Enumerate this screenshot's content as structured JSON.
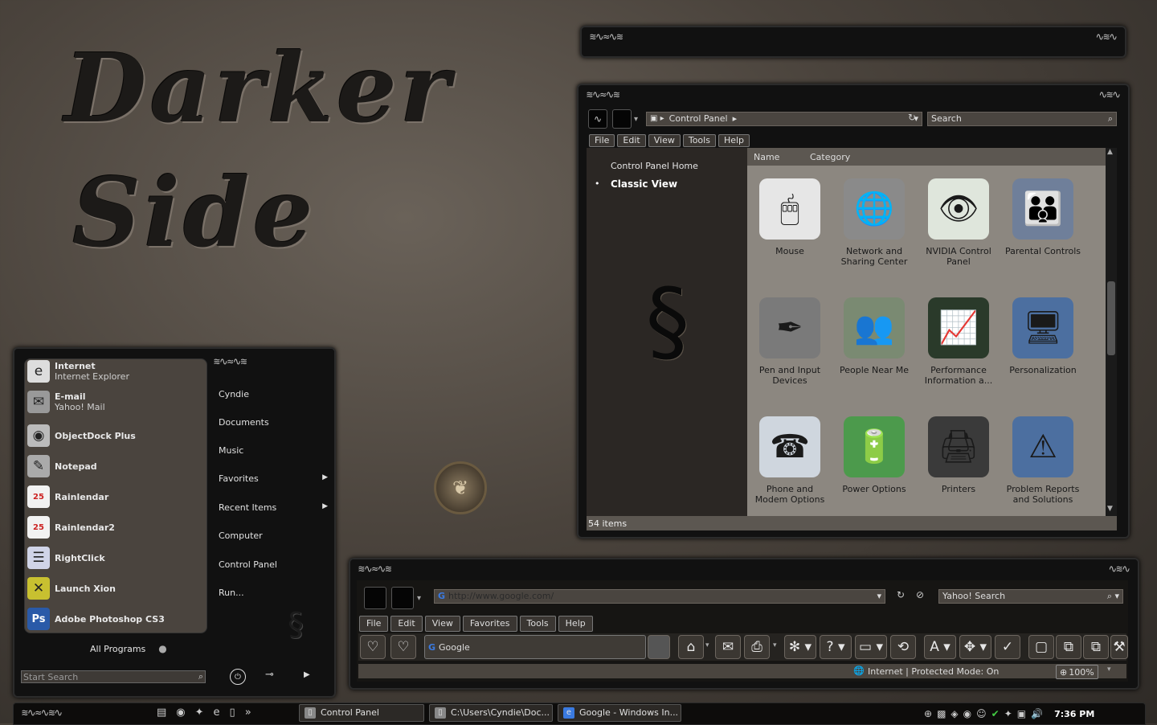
{
  "desktop": {
    "title_line1": "Darker",
    "title_line2": "Side"
  },
  "explorer": {
    "address": {
      "path_label": "Control Panel"
    },
    "search": {
      "placeholder": "Search"
    },
    "menu": [
      "File",
      "Edit",
      "View",
      "Tools",
      "Help"
    ],
    "side": {
      "home_label": "Control Panel Home",
      "classic_label": "Classic View"
    },
    "columns": {
      "name": "Name",
      "category": "Category"
    },
    "items": [
      {
        "label": "Mouse",
        "icon": "mouse-icon",
        "glyph": "🖱",
        "bg": "#e6e6e6"
      },
      {
        "label": "Network and Sharing Center",
        "icon": "globe-icon",
        "glyph": "🌐",
        "bg": "#8a8a8a"
      },
      {
        "label": "NVIDIA Control Panel",
        "icon": "nvidia-icon",
        "glyph": "👁",
        "bg": "#dfe6dc"
      },
      {
        "label": "Parental Controls",
        "icon": "parental-controls-icon",
        "glyph": "👪",
        "bg": "#6f7f9a"
      },
      {
        "label": "Pen and Input Devices",
        "icon": "pen-icon",
        "glyph": "✒",
        "bg": "#7a7a7a"
      },
      {
        "label": "People Near Me",
        "icon": "people-icon",
        "glyph": "👥",
        "bg": "#7a8a72"
      },
      {
        "label": "Performance Information a...",
        "icon": "performance-icon",
        "glyph": "📈",
        "bg": "#2a3a2a"
      },
      {
        "label": "Personalization",
        "icon": "personalization-icon",
        "glyph": "🖥",
        "bg": "#4c6fa0"
      },
      {
        "label": "Phone and Modem Options",
        "icon": "phone-icon",
        "glyph": "☎",
        "bg": "#cfd6de"
      },
      {
        "label": "Power Options",
        "icon": "battery-icon",
        "glyph": "🔋",
        "bg": "#4c9a4c"
      },
      {
        "label": "Printers",
        "icon": "printer-icon",
        "glyph": "🖨",
        "bg": "#3a3a3a"
      },
      {
        "label": "Problem Reports and Solutions",
        "icon": "problem-reports-icon",
        "glyph": "⚠",
        "bg": "#4c6fa0"
      }
    ],
    "status": "54 items"
  },
  "browser": {
    "url": "http://www.google.com/",
    "search_placeholder": "Yahoo! Search",
    "menu": [
      "File",
      "Edit",
      "View",
      "Favorites",
      "Tools",
      "Help"
    ],
    "tab_label": "Google",
    "status_zone": "Internet | Protected Mode: On",
    "zoom": "100%"
  },
  "start_menu": {
    "pinned": [
      {
        "title": "Internet",
        "sub": "Internet Explorer",
        "icon": "ie-icon",
        "glyph": "e",
        "bg": "#ddd"
      },
      {
        "title": "E-mail",
        "sub": "Yahoo! Mail",
        "icon": "mail-icon",
        "glyph": "✉",
        "bg": "#999"
      },
      {
        "title": "ObjectDock Plus",
        "sub": "",
        "icon": "objectdock-icon",
        "glyph": "◉",
        "bg": "#bbb"
      },
      {
        "title": "Notepad",
        "sub": "",
        "icon": "notepad-icon",
        "glyph": "✎",
        "bg": "#aaa"
      },
      {
        "title": "Rainlendar",
        "sub": "",
        "icon": "calendar-icon",
        "glyph": "25",
        "bg": "#f2f2f2"
      },
      {
        "title": "Rainlendar2",
        "sub": "",
        "icon": "calendar-icon",
        "glyph": "25",
        "bg": "#f2f2f2"
      },
      {
        "title": "RightClick",
        "sub": "",
        "icon": "rightclick-icon",
        "glyph": "☰",
        "bg": "#d0d4e8"
      },
      {
        "title": "Launch Xion",
        "sub": "",
        "icon": "xion-icon",
        "glyph": "✕",
        "bg": "#c8c030"
      },
      {
        "title": "Adobe Photoshop CS3",
        "sub": "",
        "icon": "photoshop-icon",
        "glyph": "Ps",
        "bg": "#2a5aa8"
      }
    ],
    "all_programs": "All Programs",
    "search_placeholder": "Start Search",
    "right": [
      "Cyndie",
      "Documents",
      "Music",
      "Favorites",
      "Recent Items",
      "Computer",
      "Control Panel",
      "Run..."
    ]
  },
  "taskbar": {
    "tasks": [
      {
        "label": "Control Panel",
        "icon": "folder-icon"
      },
      {
        "label": "C:\\Users\\Cyndie\\Doc...",
        "icon": "notepad-icon"
      },
      {
        "label": "Google - Windows In...",
        "icon": "ie-icon"
      }
    ],
    "quicklaunch_more": "»",
    "clock": "7:36 PM"
  },
  "colors": {
    "accent": "#111111",
    "panel_grey": "#8c8780",
    "sidebar_dark": "#4a443e"
  }
}
